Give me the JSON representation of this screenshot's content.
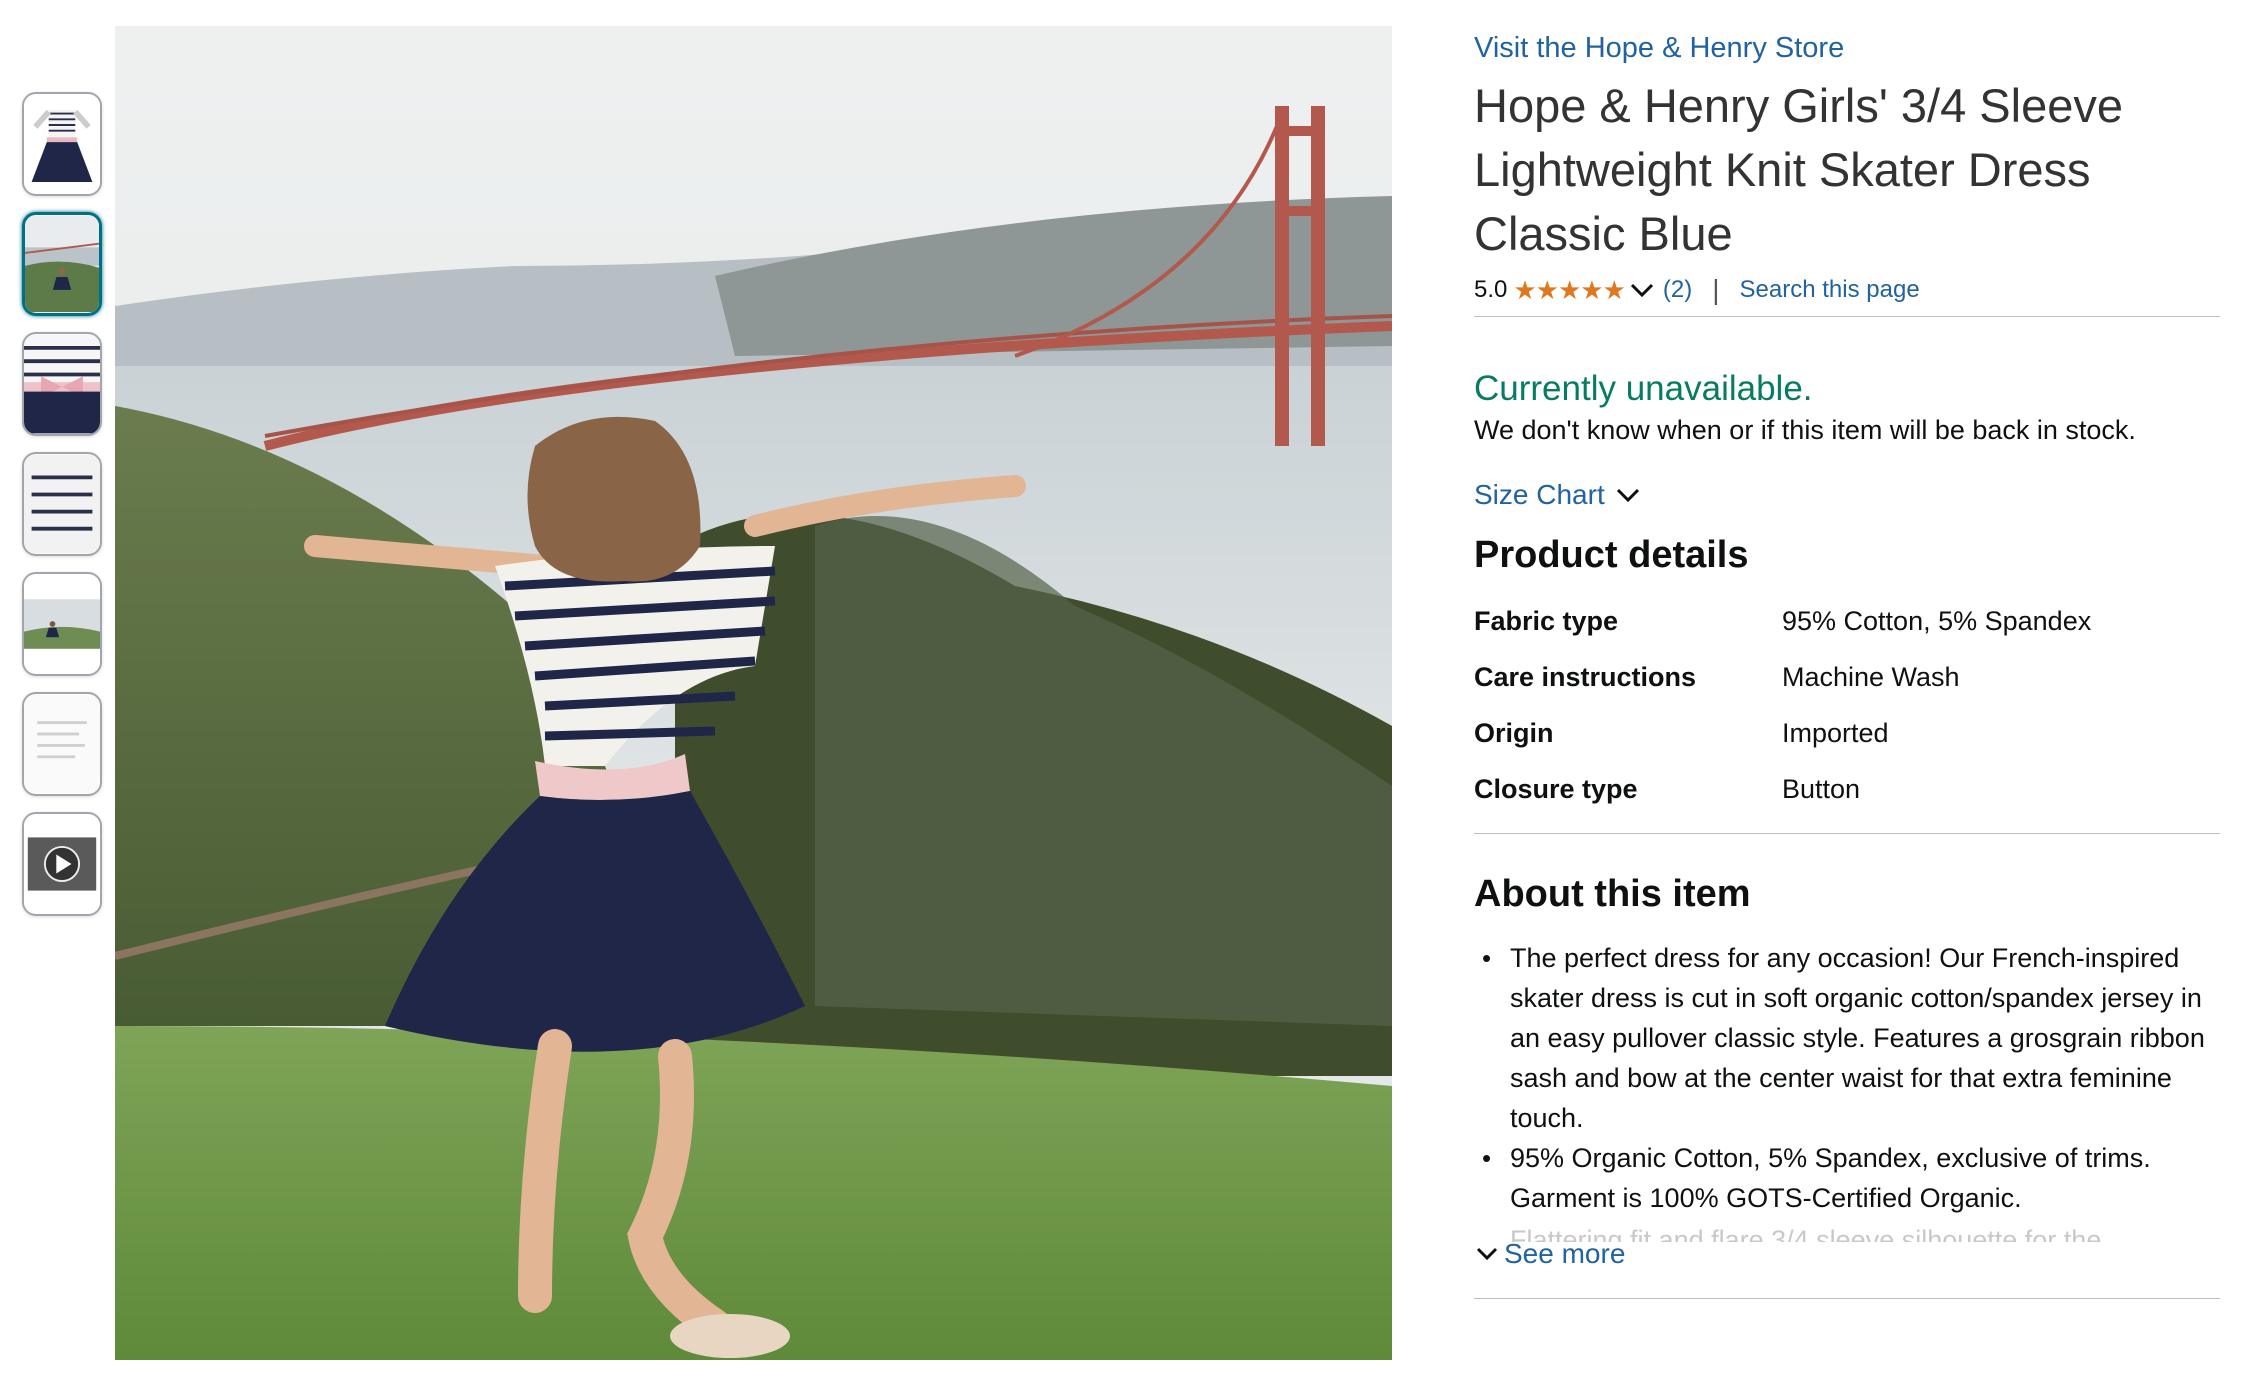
{
  "store_link": "Visit the Hope & Henry Store",
  "title": "Hope & Henry Girls' 3/4 Sleeve Lightweight Knit Skater Dress Classic Blue",
  "rating": {
    "value": "5.0",
    "stars": "★★★★★",
    "stars_count": 5,
    "count": "(2)"
  },
  "search_page": "Search this page",
  "separator": "|",
  "availability": {
    "status": "Currently unavailable.",
    "message": "We don't know when or if this item will be back in stock."
  },
  "size_chart": "Size Chart",
  "product_details": {
    "heading": "Product details",
    "rows": [
      {
        "key": "Fabric type",
        "value": "95% Cotton, 5% Spandex"
      },
      {
        "key": "Care instructions",
        "value": "Machine Wash"
      },
      {
        "key": "Origin",
        "value": "Imported"
      },
      {
        "key": "Closure type",
        "value": "Button"
      }
    ]
  },
  "about": {
    "heading": "About this item",
    "bullets": [
      "The perfect dress for any occasion! Our French-inspired skater dress is cut in soft organic cotton/spandex jersey in an easy pullover classic style. Features a grosgrain ribbon sash and bow at the center waist for that extra feminine touch.",
      "95% Organic Cotton, 5% Spandex, exclusive of trims. Garment is 100% GOTS-Certified Organic."
    ],
    "faded_text": "Flattering fit and flare 3/4 sleeve silhouette for the",
    "see_more": "See more"
  },
  "thumbnails": [
    {
      "name": "dress-front",
      "selected": false
    },
    {
      "name": "girl-bridge",
      "selected": true
    },
    {
      "name": "bow-detail",
      "selected": false
    },
    {
      "name": "stripe-back",
      "selected": false
    },
    {
      "name": "girl-field",
      "selected": false
    },
    {
      "name": "size-chart-image",
      "selected": false
    },
    {
      "name": "video",
      "selected": false
    }
  ],
  "colors": {
    "link": "#2162a1",
    "available_green": "#067d62",
    "star": "#de7921",
    "selected_thumb": "#007185"
  }
}
